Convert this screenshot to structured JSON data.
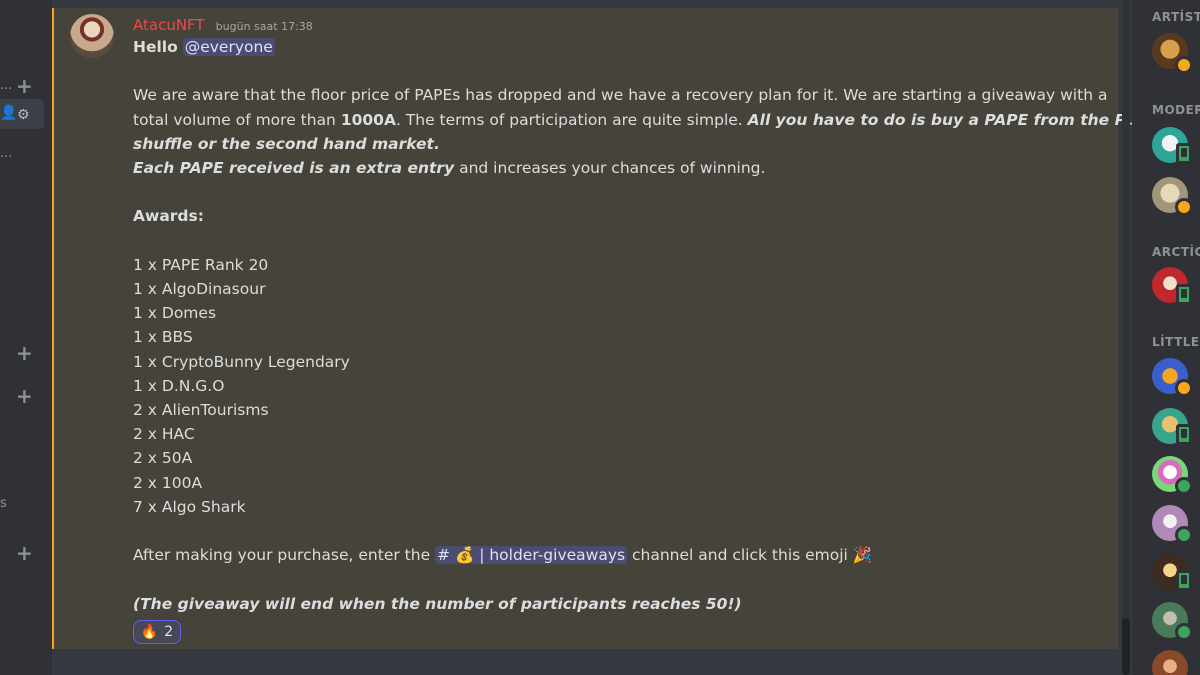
{
  "sidebar": {
    "truncated_items": [
      "...",
      "..."
    ],
    "truncated_letter": "s"
  },
  "message": {
    "author": "AtacuNFT",
    "timestamp": "bugün saat 17:38",
    "greeting": "Hello",
    "mention": "@everyone",
    "para1": {
      "l1": "We are aware that the floor price of PAPEs has dropped and we have a recovery plan for it. We are starting a giveaway with a",
      "l2_pre": "total volume of more than ",
      "l2_bold": "1000A",
      "l2_mid": ". The terms of participation are quite simple. ",
      "l2_bi": "All you have to do is buy a PAPE from the Public",
      "l3_bi": "shuffle or the second hand market.",
      "l4_bi": "Each PAPE received is an extra entry",
      "l4_rest": " and increases your chances of winning."
    },
    "awards_title": "Awards:",
    "awards": [
      "1  x PAPE Rank 20",
      "1  x AlgoDinasour",
      "1 x Domes",
      "1 x BBS",
      "1  x CryptoBunny Legendary",
      "1  x D.N.G.O",
      "2 x AlienTourisms",
      "2 x HAC",
      "2 x 50A",
      "2 x 100A",
      "7 x Algo Shark"
    ],
    "after_pre": "After making your purchase, enter the ",
    "channel": "# 💰 | holder-giveaways",
    "after_post": " channel and click this emoji ",
    "party_emoji": "🎉",
    "ending": "(The giveaway will end when the number of participants reaches 50!)"
  },
  "reaction": {
    "emoji": "🔥",
    "count": "2"
  },
  "members": {
    "roles": [
      "ARTİST",
      "MODER",
      "ARCTİC",
      "LİTTLE"
    ]
  },
  "colors": {
    "accent": "#faa61a",
    "author": "#f04747",
    "mention_bg": "#5865f2",
    "online": "#3ba55d",
    "idle": "#faa61a"
  }
}
